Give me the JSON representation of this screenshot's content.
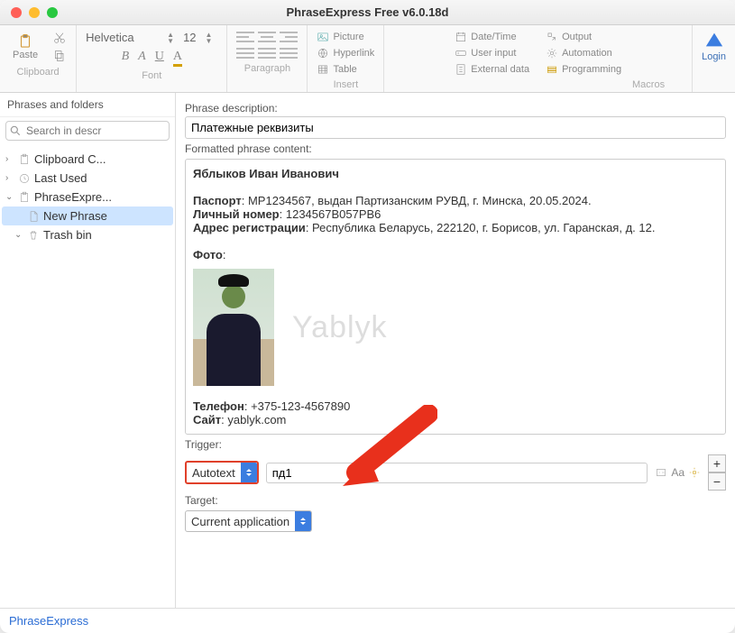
{
  "window": {
    "title": "PhraseExpress Free v6.0.18d"
  },
  "ribbon": {
    "clipboard": {
      "paste": "Paste",
      "label": "Clipboard"
    },
    "font": {
      "name": "Helvetica",
      "size": "12",
      "bold": "B",
      "italic": "A",
      "underline": "U",
      "color": "A",
      "label": "Font"
    },
    "paragraph": {
      "label": "Paragraph"
    },
    "insert": {
      "picture": "Picture",
      "hyperlink": "Hyperlink",
      "table": "Table",
      "label": "Insert"
    },
    "macros": {
      "datetime": "Date/Time",
      "userinput": "User input",
      "externaldata": "External data",
      "output": "Output",
      "automation": "Automation",
      "programming": "Programming",
      "label": "Macros"
    },
    "login": "Login"
  },
  "sidebar": {
    "title": "Phrases and folders",
    "search_placeholder": "Search in descr",
    "items": [
      {
        "label": "Clipboard C..."
      },
      {
        "label": "Last Used"
      },
      {
        "label": "PhraseExpre..."
      },
      {
        "label": "New Phrase"
      },
      {
        "label": "Trash bin"
      }
    ]
  },
  "main": {
    "desc_label": "Phrase description:",
    "desc_value": "Платежные реквизиты",
    "content_label": "Formatted phrase content:",
    "content": {
      "name": "Яблыков Иван Иванович",
      "passport_label": "Паспорт",
      "passport_value": ": MP1234567, выдан Партизанским РУВД, г. Минска, 20.05.2024.",
      "personal_label": "Личный номер",
      "personal_value": ": 1234567B057PB6",
      "address_label": "Адрес регистрации",
      "address_value": ": Республика Беларусь, 222120, г. Борисов, ул. Гаранская, д. 12.",
      "photo_label": "Фото",
      "watermark": "Yablyk",
      "phone_label": "Телефон",
      "phone_value": ": +375-123-4567890",
      "site_label": "Сайт",
      "site_value": ": yablyk.com"
    },
    "trigger_label": "Trigger:",
    "trigger_type": "Autotext",
    "trigger_value": "пд1",
    "target_label": "Target:",
    "target_value": "Current application"
  },
  "footer": {
    "link": "PhraseExpress"
  }
}
